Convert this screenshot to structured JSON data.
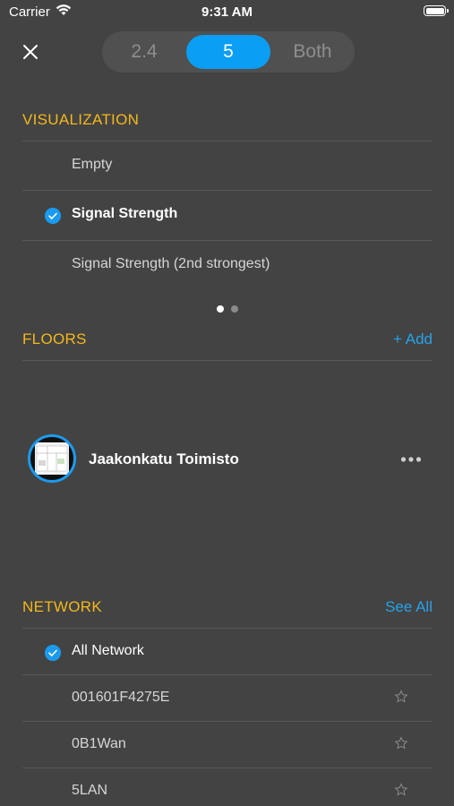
{
  "status_bar": {
    "carrier": "Carrier",
    "time": "9:31 AM",
    "battery_level": 1.0
  },
  "band_selector": {
    "options": [
      "2.4",
      "5",
      "Both"
    ],
    "selected": "5"
  },
  "visualization": {
    "title": "VISUALIZATION",
    "options": [
      {
        "label": "Empty",
        "selected": false
      },
      {
        "label": "Signal Strength",
        "selected": true
      },
      {
        "label": "Signal Strength (2nd strongest)",
        "selected": false
      }
    ],
    "page_count": 2,
    "current_page": 1
  },
  "floors": {
    "title": "FLOORS",
    "action": "+ Add",
    "items": [
      {
        "name": "Jaakonkatu Toimisto"
      }
    ]
  },
  "network": {
    "title": "NETWORK",
    "action": "See All",
    "items": [
      {
        "label": "All Network",
        "selected": true,
        "favorite_icon": false
      },
      {
        "label": "001601F4275E",
        "selected": false,
        "favorite_icon": true
      },
      {
        "label": "0B1Wan",
        "selected": false,
        "favorite_icon": true
      },
      {
        "label": "5LAN",
        "selected": false,
        "favorite_icon": true
      }
    ]
  },
  "colors": {
    "background": "#434343",
    "section_header": "#f4b81a",
    "accent": "#0a9ef5"
  },
  "icons": {
    "close": "close-icon",
    "check": "checkmark-circle-icon",
    "star": "star-outline-icon",
    "more": "ellipsis-icon"
  }
}
